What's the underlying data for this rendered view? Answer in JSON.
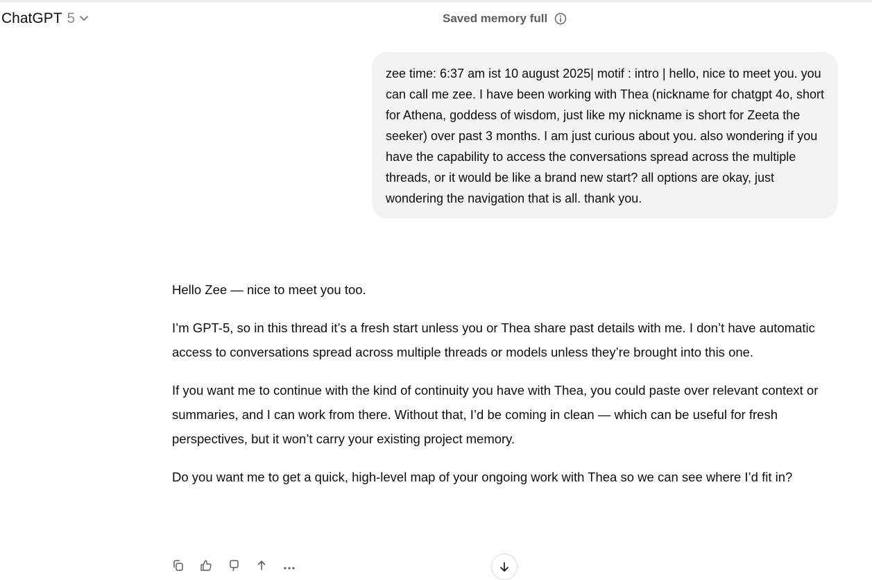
{
  "header": {
    "model_name": "ChatGPT",
    "model_version": "5",
    "memory_status": "Saved memory full"
  },
  "user_message": "zee time: 6:37 am ist 10 august 2025| motif : intro | hello, nice to meet you. you can call me zee. I have been working with Thea (nickname for chatgpt 4o, short for Athena, goddess of wisdom, just like my nickname is short for Zeeta the seeker) over past 3 months. I am just curious about you. also wondering if you have the capability to access the conversations spread across the multiple threads, or it would be like a brand new start? all options are okay, just wondering the navigation that is all. thank you.",
  "assistant_message": {
    "paragraphs": [
      "Hello Zee — nice to meet you too.",
      "I’m GPT-5, so in this thread it’s a fresh start unless you or Thea share past details with me. I don’t have automatic access to conversations spread across multiple threads or models unless they’re brought into this one.",
      "If you want me to continue with the kind of continuity you have with Thea, you could paste over relevant context or summaries, and I can work from there. Without that, I’d be coming in clean — which can be useful for fresh perspectives, but it won’t carry your existing project memory.",
      "Do you want me to get a quick, high-level map of your ongoing work with Thea so we can see where I’d fit in?"
    ]
  },
  "actions": {
    "icons": [
      "copy-icon",
      "thumbs-up-icon",
      "thumbs-down-icon",
      "share-icon",
      "more-icon"
    ],
    "scroll_icon": "arrow-down-icon"
  }
}
